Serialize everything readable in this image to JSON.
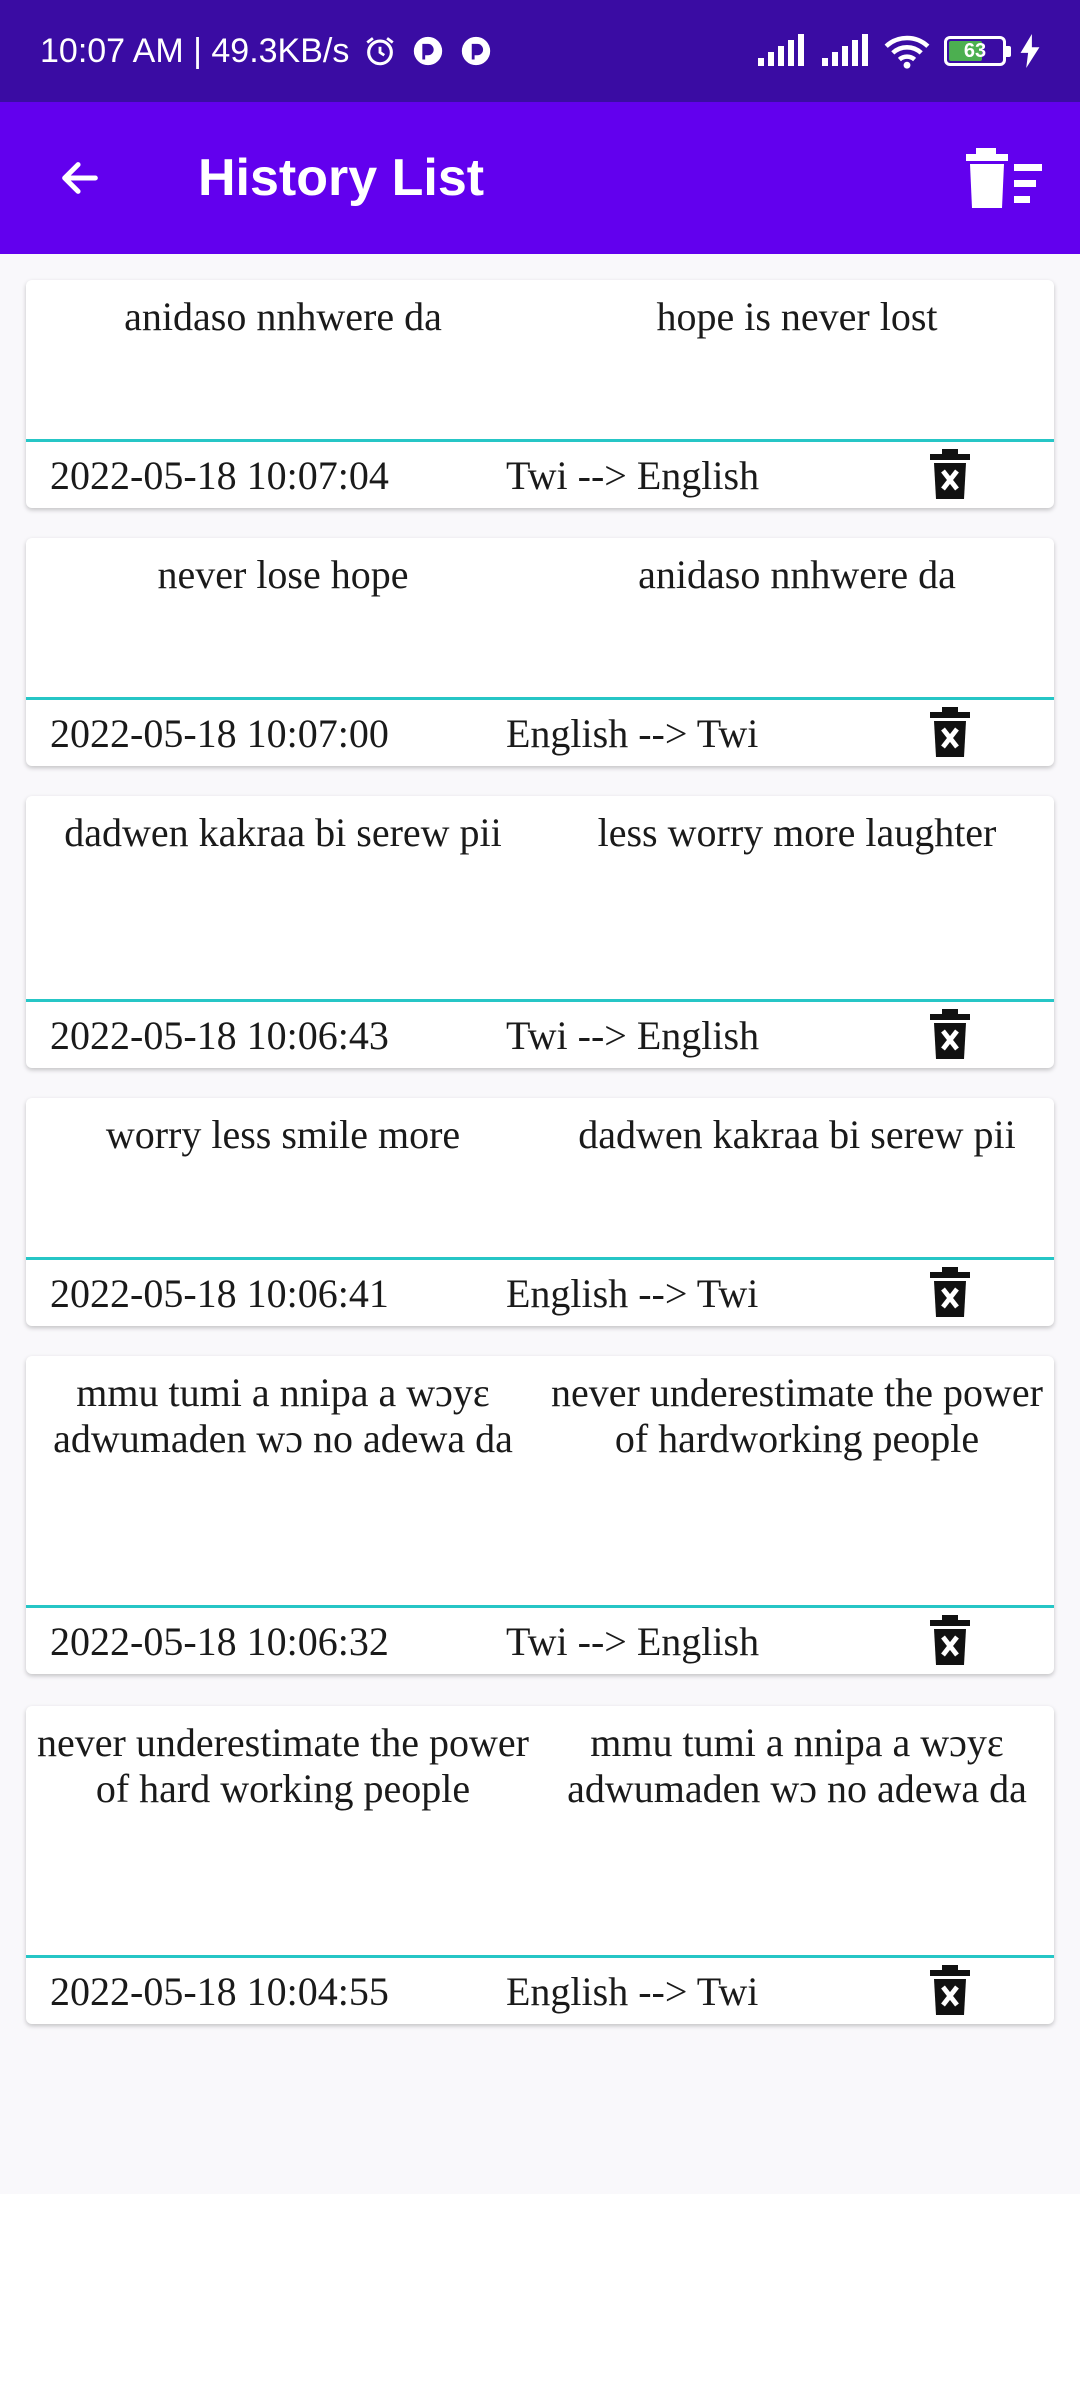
{
  "status_bar": {
    "time_speed": "10:07 AM | 49.3KB/s",
    "battery_level": "63",
    "battery_fraction": 0.63,
    "icons": [
      "alarm-icon",
      "app-notification-icon",
      "app-notification-icon",
      "signal-icon",
      "signal-icon",
      "wifi-icon",
      "battery-icon",
      "charging-icon"
    ]
  },
  "app_bar": {
    "title": "History List",
    "back_icon": "arrow-left-icon",
    "clear_icon": "delete-sweep-icon"
  },
  "colors": {
    "status_bar": "#3a0ca3",
    "app_bar": "#6200ee",
    "divider": "#26c6c6",
    "list_bg": "#f9f8fb"
  },
  "history": [
    {
      "source": "anidaso nnhwere da",
      "target": "hope is never lost",
      "datetime": "2022-05-18 10:07:04",
      "direction": "Twi --> English"
    },
    {
      "source": "never lose hope",
      "target": "anidaso nnhwere da",
      "datetime": "2022-05-18 10:07:00",
      "direction": "English --> Twi"
    },
    {
      "source": "dadwen kakraa bi serew pii",
      "target": "less worry more laughter",
      "datetime": "2022-05-18 10:06:43",
      "direction": "Twi --> English"
    },
    {
      "source": "worry less smile more",
      "target": "dadwen kakraa bi serew pii",
      "datetime": "2022-05-18 10:06:41",
      "direction": "English --> Twi"
    },
    {
      "source": "mmu tumi a nnipa a wɔyɛ adwumaden wɔ no adewa da",
      "target": "never underestimate the power of hardworking people",
      "datetime": "2022-05-18 10:06:32",
      "direction": "Twi --> English"
    },
    {
      "source": "never underestimate the power of hard working people",
      "target": "mmu tumi a nnipa a wɔyɛ adwumaden wɔ no adewa da",
      "datetime": "2022-05-18 10:04:55",
      "direction": "English --> Twi"
    }
  ]
}
